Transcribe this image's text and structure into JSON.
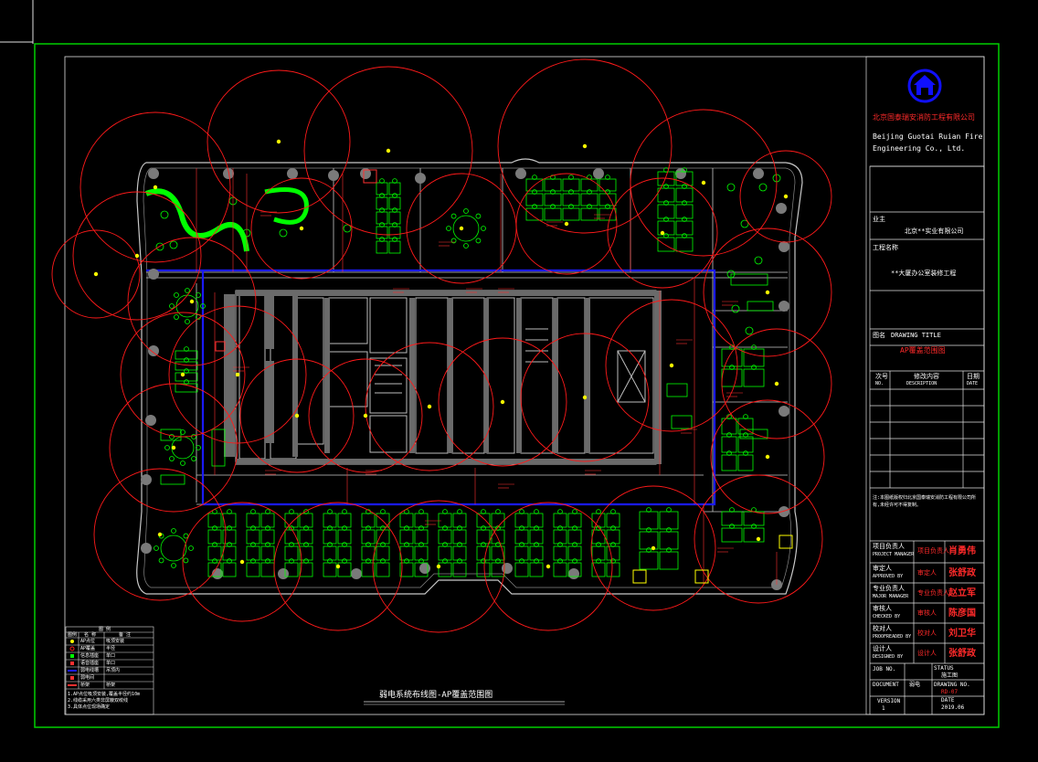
{
  "company": {
    "name_cn": "北京国泰瑞安消防工程有限公司",
    "name_en_1": "Beijing Guotai Ruian Fire",
    "name_en_2": "Engineering Co., Ltd."
  },
  "drawing_title": "弱电系统布线图-AP覆盖范围图",
  "title_block": {
    "owner_label": "业主",
    "owner_value": "北京**实业有限公司",
    "project_label": "工程名称",
    "project_value": "**大厦办公室装修工程",
    "sheet_label": "图名",
    "sheet_label_en": "DRAWING TITLE",
    "sheet_value": "AP覆盖范围图",
    "revision_headers": [
      "次号",
      "修改内容",
      "日期"
    ],
    "revision_headers_en": [
      "NO.",
      "DESCRIPTION",
      "DATE"
    ],
    "notes": "注:本图纸版权归北京国泰瑞安消防工程有限公司所有,未经许可不得复制。",
    "roles": [
      {
        "cn": "项目负责人",
        "en": "PROJECT MANAGER",
        "sig": "肖勇伟"
      },
      {
        "cn": "审定人",
        "en": "APPROVED BY",
        "sig": "张舒政"
      },
      {
        "cn": "专业负责人",
        "en": "MAJOR MANAGER",
        "sig": "赵立军"
      },
      {
        "cn": "审核人",
        "en": "CHECKED BY",
        "sig": "陈彦国"
      },
      {
        "cn": "校对人",
        "en": "PROOFREADED BY",
        "sig": "刘卫华"
      },
      {
        "cn": "设计人",
        "en": "DESIGNED BY",
        "sig": "张舒政"
      }
    ],
    "job_no_label": "JOB NO.",
    "status_label": "STATUS",
    "status_value": "施工图",
    "doc_label": "DOCUMENT",
    "doc_value": "弱电",
    "dwg_no_label": "DRAWING NO.",
    "dwg_no_value": "RD-07",
    "version_label": "VERSION",
    "version_value": "1",
    "date_label": "DATE",
    "date_value": "2019.06"
  },
  "legend": {
    "title": "图  例",
    "headers": [
      "图例",
      "名 称",
      "备  注"
    ],
    "rows": [
      {
        "name": "AP点位",
        "note": "吸顶安装"
      },
      {
        "name": "AP覆盖",
        "note": "半径"
      },
      {
        "name": "信息插座",
        "note": "单口"
      },
      {
        "name": "语音插座",
        "note": "单口"
      },
      {
        "name": "弱电线槽",
        "note": "吊顶内"
      },
      {
        "name": "弱电间",
        "note": ""
      },
      {
        "name": "桥架",
        "note": "桥架"
      }
    ],
    "footnotes": [
      "1.AP点位吸顶安装,覆盖半径约10m",
      "2.线缆采用六类非屏蔽双绞线",
      "3.具体点位现场确定"
    ]
  },
  "colors": {
    "background": "#000000",
    "frame": "#00d000",
    "coverage": "#ff1a1a",
    "walls": "#c8c8c8",
    "furniture": "#00ff00",
    "tray": "#1a1aff",
    "labels": "#ff4040",
    "yellow": "#ffff00",
    "logo": "#1010ff"
  },
  "icons": {
    "logo": "company-logo",
    "ap": "ap-point"
  }
}
